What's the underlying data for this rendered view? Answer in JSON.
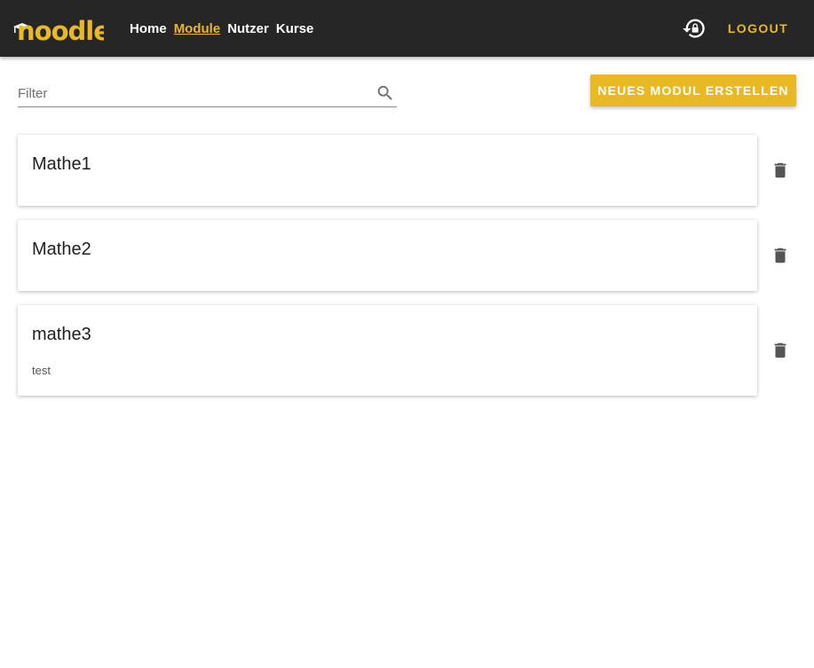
{
  "header": {
    "logo_text": "noodle",
    "nav": [
      {
        "label": "Home",
        "active": false
      },
      {
        "label": "Module",
        "active": true
      },
      {
        "label": "Nutzer",
        "active": false
      },
      {
        "label": "Kurse",
        "active": false
      }
    ],
    "lock_icon": "lock-rotate-icon",
    "logout_label": "LOGOUT",
    "accent_color": "#e8b925",
    "bar_color": "#262626"
  },
  "filter": {
    "placeholder": "Filter",
    "value": "",
    "icon": "search-icon"
  },
  "new_button_label": "NEUES MODUL ERSTELLEN",
  "modules": [
    {
      "title": "Mathe1",
      "description": ""
    },
    {
      "title": "Mathe2",
      "description": ""
    },
    {
      "title": "mathe3",
      "description": "test"
    }
  ],
  "delete_icon": "trash-icon"
}
